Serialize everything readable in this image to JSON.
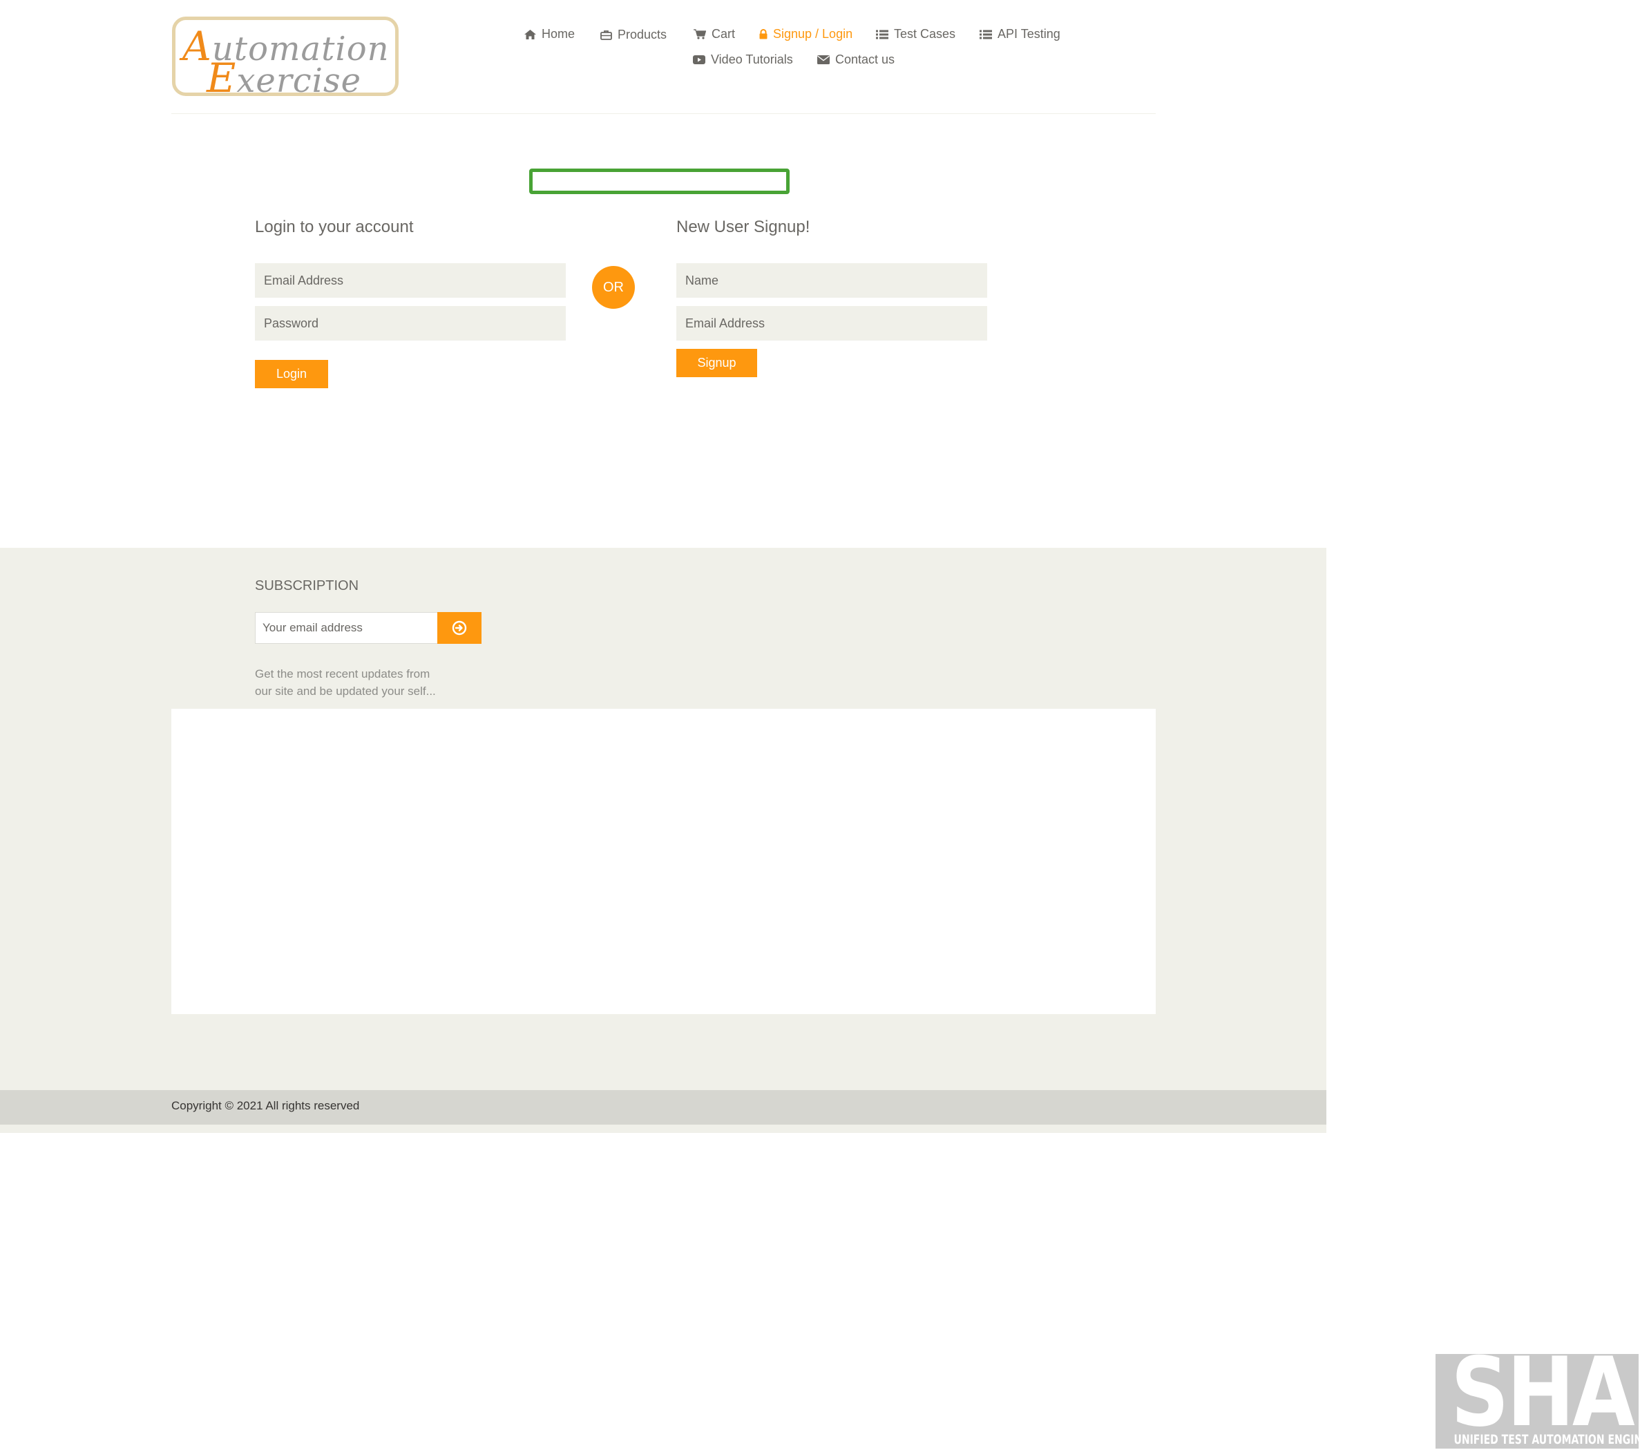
{
  "brand": {
    "logo_line1": "Automation",
    "logo_line2": "Exercise"
  },
  "nav": {
    "items": [
      {
        "label": "Home",
        "icon": "home-icon"
      },
      {
        "label": "Products",
        "icon": "products-icon"
      },
      {
        "label": "Cart",
        "icon": "cart-icon"
      },
      {
        "label": "Signup / Login",
        "icon": "lock-icon",
        "active": true
      },
      {
        "label": "Test Cases",
        "icon": "list-icon"
      },
      {
        "label": "API Testing",
        "icon": "list-icon"
      },
      {
        "label": "Video Tutorials",
        "icon": "youtube-icon"
      },
      {
        "label": "Contact us",
        "icon": "envelope-icon"
      }
    ]
  },
  "login": {
    "heading": "Login to your account",
    "email_placeholder": "Email Address",
    "password_placeholder": "Password",
    "button_label": "Login"
  },
  "divider": {
    "label": "OR"
  },
  "signup": {
    "heading": "New User Signup!",
    "name_placeholder": "Name",
    "email_placeholder": "Email Address",
    "button_label": "Signup"
  },
  "footer": {
    "subscription_title": "SUBSCRIPTION",
    "subscription_placeholder": "Your email address",
    "subscription_description_line1": "Get the most recent updates from",
    "subscription_description_line2": "our site and be updated your self...",
    "copyright": "Copyright © 2021 All rights reserved"
  },
  "watermark": {
    "title": "SHAFT",
    "subtitle": "UNIFIED TEST AUTOMATION ENGINE"
  },
  "colors": {
    "accent": "#FE980F",
    "text": "#696763",
    "field_bg": "#F0F0E9",
    "highlight_border": "#48A335",
    "copyright_bar": "#D6D6D0"
  }
}
